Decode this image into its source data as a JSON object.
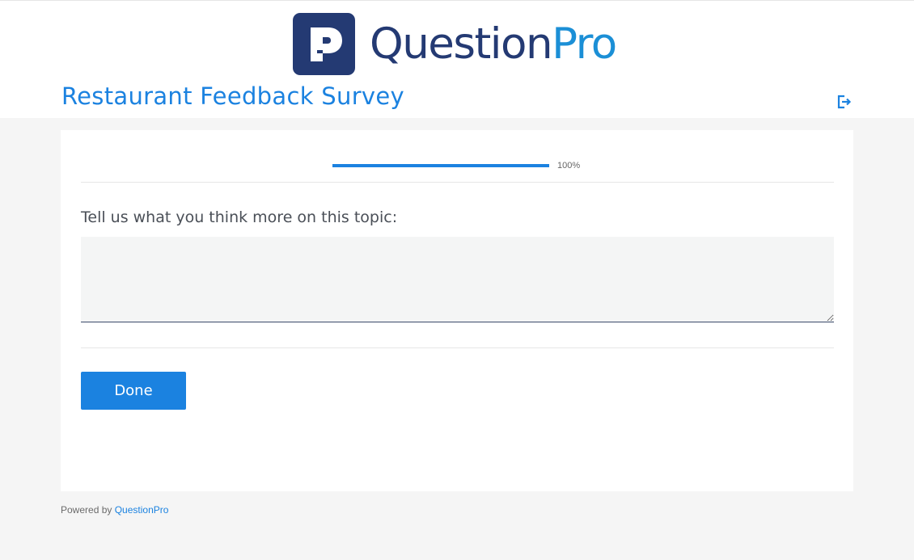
{
  "header": {
    "logo": {
      "brand_part1": "Question",
      "brand_part2": "Pro",
      "icon": "questionpro-logo-icon",
      "colors": {
        "dark": "#243a73",
        "light": "#1b8fd6"
      }
    },
    "survey_title": "Restaurant Feedback Survey",
    "exit_icon": "exit-icon"
  },
  "progress": {
    "value": 1.0,
    "label": "100%"
  },
  "question": {
    "text": "Tell us what you think more on this topic:",
    "answer_value": "",
    "answer_placeholder": ""
  },
  "actions": {
    "done_label": "Done"
  },
  "footer": {
    "powered_by": "Powered by",
    "brand_link": "QuestionPro"
  },
  "colors": {
    "accent": "#1b82e0",
    "background": "#f5f5f5",
    "text": "#4a4f57"
  }
}
